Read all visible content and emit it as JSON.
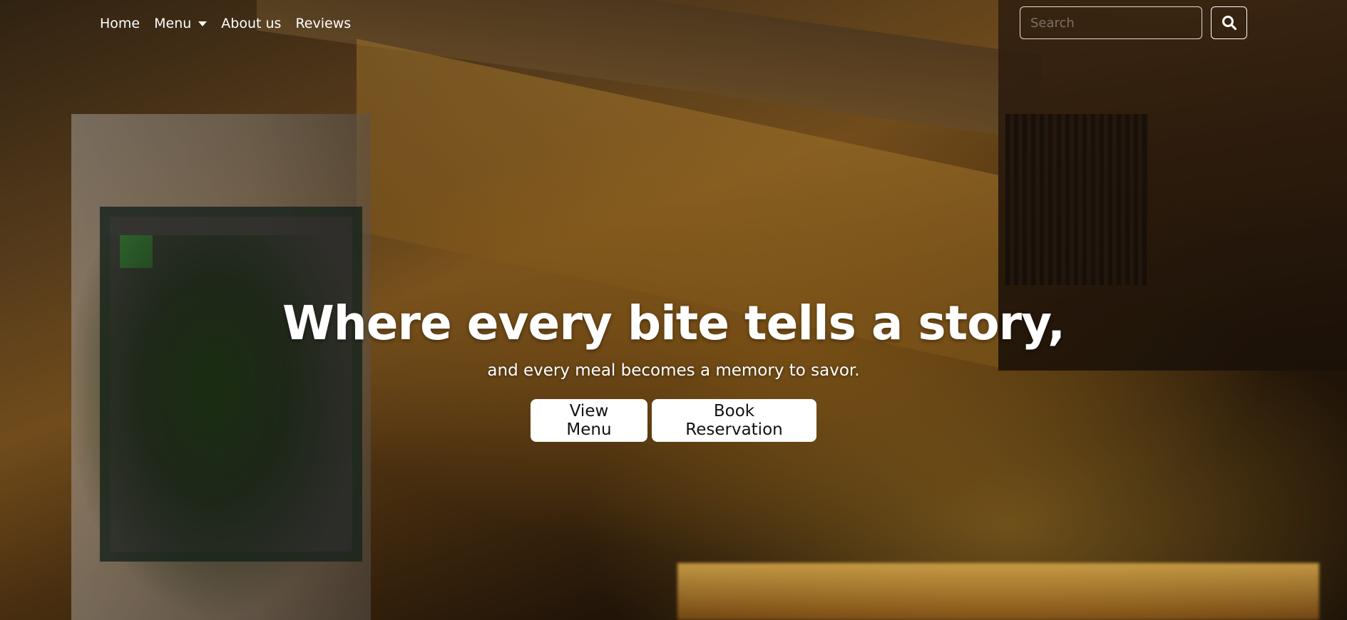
{
  "nav": {
    "links": [
      {
        "label": "Home"
      },
      {
        "label": "Menu",
        "has_dropdown": true
      },
      {
        "label": "About us"
      },
      {
        "label": "Reviews"
      }
    ]
  },
  "search": {
    "placeholder": "Search",
    "value": "",
    "button_icon": "search-icon"
  },
  "hero": {
    "title": "Where every bite tells a story,",
    "subtitle": "and every meal becomes a memory to savor.",
    "buttons": {
      "view_menu": "View Menu",
      "book_reservation": "Book Reservation"
    }
  },
  "colors": {
    "text": "#ffffff",
    "button_bg": "#ffffff",
    "button_text": "#111111"
  }
}
